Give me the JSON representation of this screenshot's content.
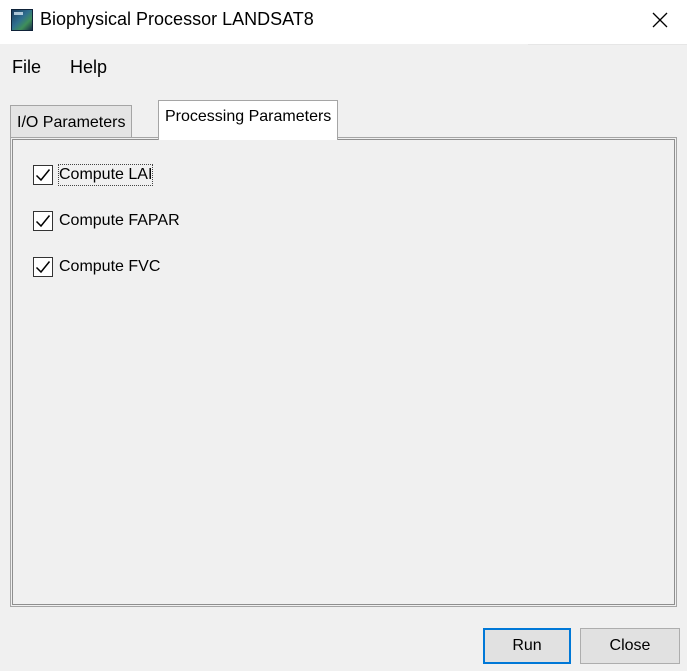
{
  "window": {
    "title": "Biophysical Processor LANDSAT8",
    "app_icon": "landsat-app-icon",
    "close_icon": "close-icon"
  },
  "menu": {
    "items": [
      {
        "label": "File"
      },
      {
        "label": "Help"
      }
    ]
  },
  "tabs": [
    {
      "label": "I/O Parameters",
      "selected": false
    },
    {
      "label": "Processing Parameters",
      "selected": true
    }
  ],
  "options": [
    {
      "label": "Compute LAI",
      "checked": true,
      "focused": true
    },
    {
      "label": "Compute FAPAR",
      "checked": true,
      "focused": false
    },
    {
      "label": "Compute FVC",
      "checked": true,
      "focused": false
    }
  ],
  "buttons": {
    "run_label": "Run",
    "close_label": "Close"
  },
  "colors": {
    "focus_border": "#0078d7",
    "window_bg": "#f0f0f0"
  }
}
